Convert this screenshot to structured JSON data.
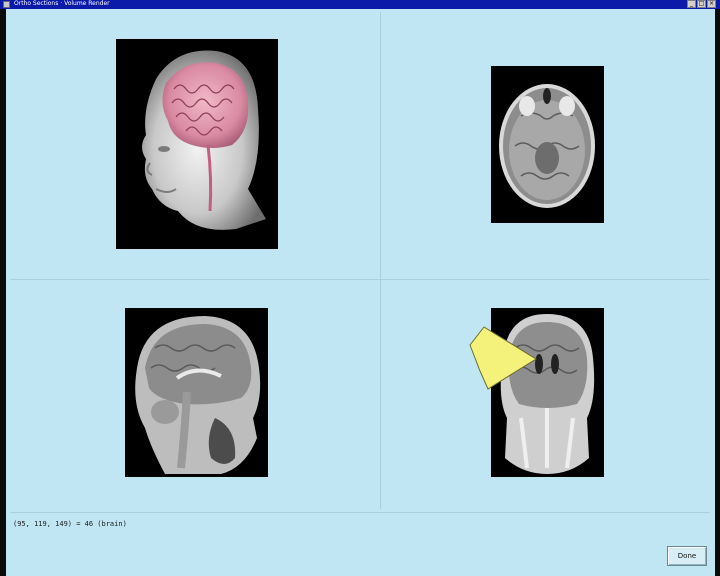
{
  "window": {
    "title": "Ortho Sections · Volume Render",
    "controls": [
      "_",
      "□",
      "×"
    ]
  },
  "views": [
    {
      "name": "volume-render",
      "description": "3D head"
    },
    {
      "name": "axial-slice"
    },
    {
      "name": "sagittal-slice"
    },
    {
      "name": "coronal-slice"
    }
  ],
  "status": {
    "readout": "(95, 119, 149) = 46 (brain)"
  },
  "buttons": {
    "done_label": "Done"
  },
  "colors": {
    "background": "#bfe6f2",
    "titlebar": "#0b1aa8",
    "pointer": "#f4f27a"
  }
}
